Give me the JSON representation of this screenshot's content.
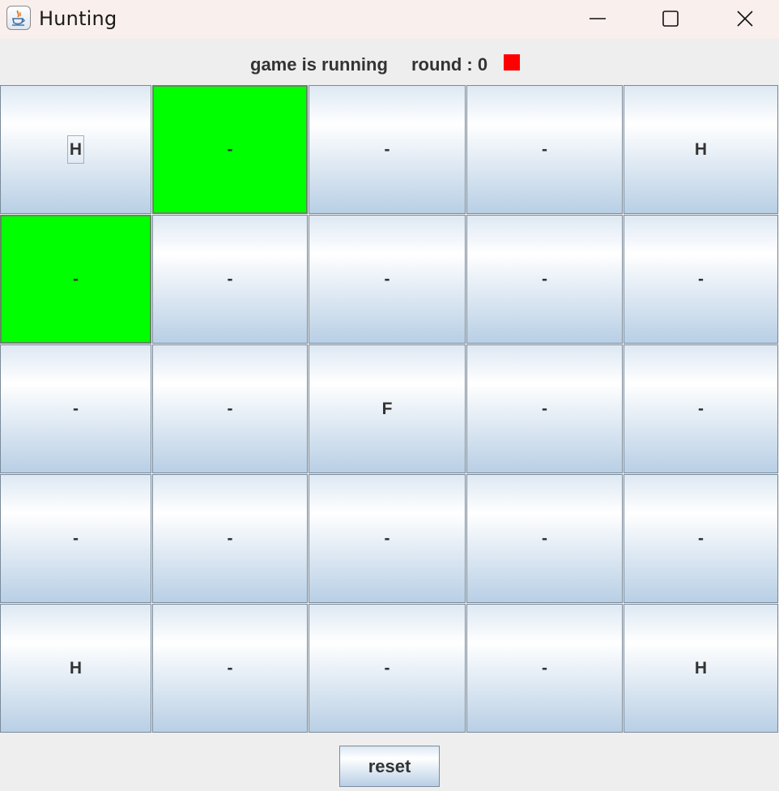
{
  "window": {
    "title": "Hunting",
    "icon": "java-cup-icon",
    "controls": [
      "minimize-icon",
      "maximize-icon",
      "close-icon"
    ]
  },
  "status": {
    "state_text": "game is running",
    "round_text": "round : 0",
    "indicator_color": "#ff0000"
  },
  "grid": {
    "rows": 5,
    "cols": 5,
    "highlight_color": "#00ff00",
    "cells": [
      {
        "label": "H",
        "highlighted": false,
        "focused": true
      },
      {
        "label": "-",
        "highlighted": true,
        "focused": false
      },
      {
        "label": "-",
        "highlighted": false,
        "focused": false
      },
      {
        "label": "-",
        "highlighted": false,
        "focused": false
      },
      {
        "label": "H",
        "highlighted": false,
        "focused": false
      },
      {
        "label": "-",
        "highlighted": true,
        "focused": false
      },
      {
        "label": "-",
        "highlighted": false,
        "focused": false
      },
      {
        "label": "-",
        "highlighted": false,
        "focused": false
      },
      {
        "label": "-",
        "highlighted": false,
        "focused": false
      },
      {
        "label": "-",
        "highlighted": false,
        "focused": false
      },
      {
        "label": "-",
        "highlighted": false,
        "focused": false
      },
      {
        "label": "-",
        "highlighted": false,
        "focused": false
      },
      {
        "label": "F",
        "highlighted": false,
        "focused": false
      },
      {
        "label": "-",
        "highlighted": false,
        "focused": false
      },
      {
        "label": "-",
        "highlighted": false,
        "focused": false
      },
      {
        "label": "-",
        "highlighted": false,
        "focused": false
      },
      {
        "label": "-",
        "highlighted": false,
        "focused": false
      },
      {
        "label": "-",
        "highlighted": false,
        "focused": false
      },
      {
        "label": "-",
        "highlighted": false,
        "focused": false
      },
      {
        "label": "-",
        "highlighted": false,
        "focused": false
      },
      {
        "label": "H",
        "highlighted": false,
        "focused": false
      },
      {
        "label": "-",
        "highlighted": false,
        "focused": false
      },
      {
        "label": "-",
        "highlighted": false,
        "focused": false
      },
      {
        "label": "-",
        "highlighted": false,
        "focused": false
      },
      {
        "label": "H",
        "highlighted": false,
        "focused": false
      }
    ]
  },
  "reset_button": {
    "label": "reset"
  }
}
